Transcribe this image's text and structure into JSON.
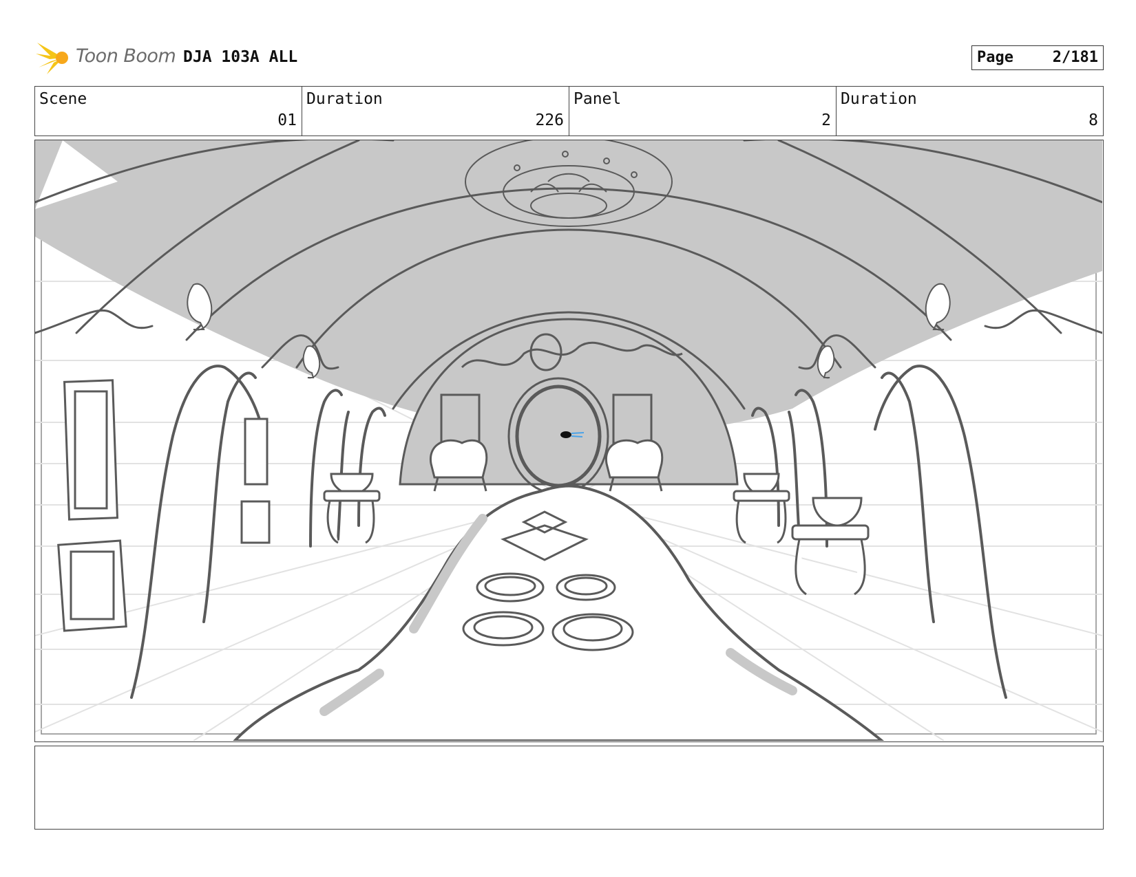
{
  "header": {
    "logo": {
      "text": "Toon Boom",
      "accent_color": "#f5c518"
    },
    "title": "DJA 103A ALL",
    "page": {
      "label": "Page",
      "value": "2/181"
    }
  },
  "info": {
    "scene_label": "Scene",
    "scene_value": "01",
    "scene_duration_label": "Duration",
    "scene_duration_value": "226",
    "panel_label": "Panel",
    "panel_value": "2",
    "panel_duration_label": "Duration",
    "panel_duration_value": "8"
  },
  "panel": {
    "shade_color": "#c8c8c8",
    "line_color": "#5a5a5a",
    "guide_color": "#e2e2e2",
    "accent_color": "#4aa3e8"
  },
  "notes": {
    "text": ""
  }
}
